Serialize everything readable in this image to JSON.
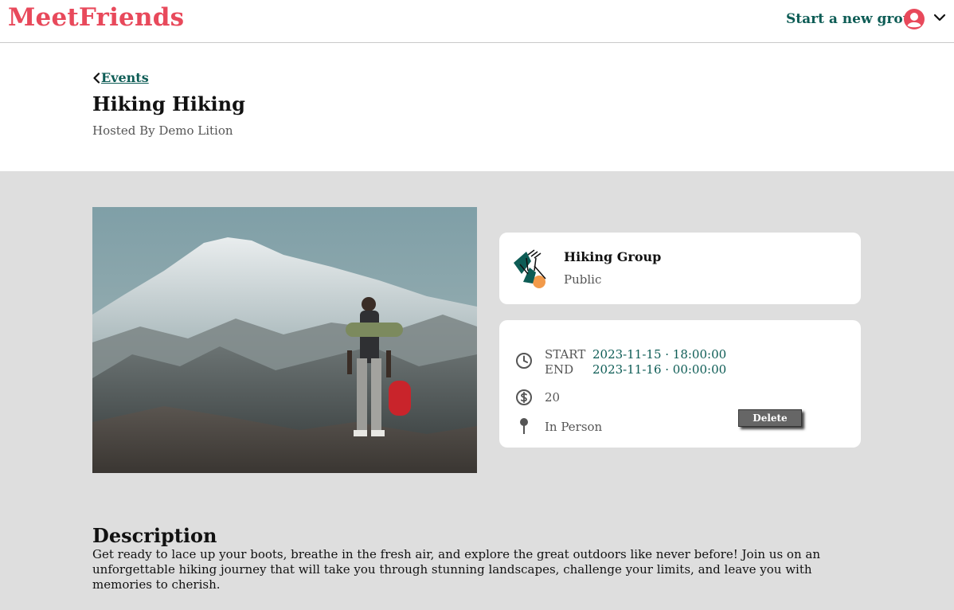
{
  "header": {
    "logo": "MeetFriends",
    "start_group_label": "Start a new group",
    "avatar_icon": "user-circle-icon",
    "menu_icon": "chevron-down-icon"
  },
  "event": {
    "back_label": "Events",
    "title": "Hiking Hiking",
    "hosted_by": "Hosted By Demo Lition",
    "image_alt": "hiker-on-mountain-photo"
  },
  "group": {
    "name": "Hiking Group",
    "privacy": "Public"
  },
  "details": {
    "start_label": "START",
    "start_value": "2023-11-15 · 18:00:00",
    "end_label": "END",
    "end_value": "2023-11-16 · 00:00:00",
    "price": "20",
    "location_type": "In Person",
    "delete_label": "Delete"
  },
  "description": {
    "heading": "Description",
    "text": "Get ready to lace up your boots, breathe in the fresh air, and explore the great outdoors like never before! Join us on an unforgettable hiking journey that will take you through stunning landscapes, challenge your limits, and leave you with memories to cherish."
  },
  "colors": {
    "brand": "#e8495b",
    "accent": "#0d5c55",
    "body_background": "#dedede"
  }
}
